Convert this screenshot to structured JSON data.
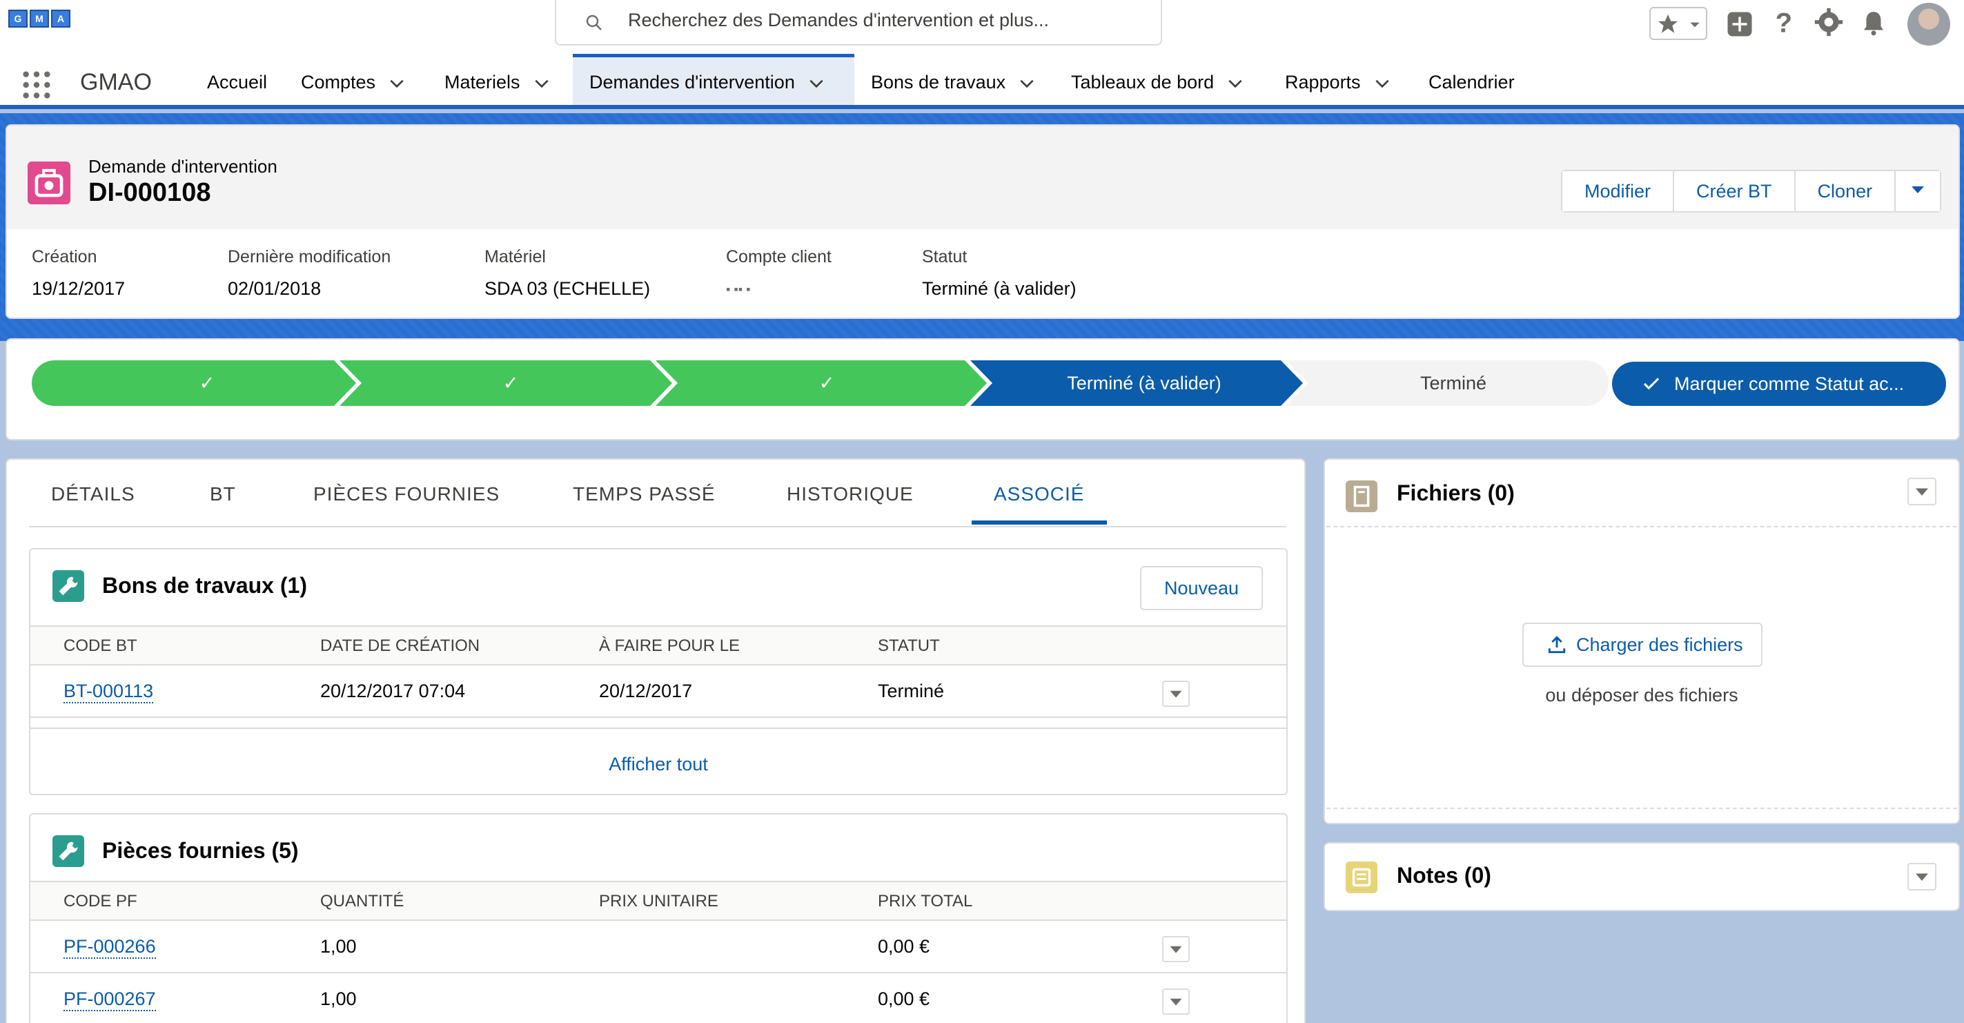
{
  "topbar": {
    "logo_letters": [
      "G",
      "M",
      "A"
    ],
    "search_placeholder": "Recherchez des Demandes d'intervention et plus..."
  },
  "nav": {
    "app_name": "GMAO",
    "items": [
      {
        "label": "Accueil",
        "has_menu": false,
        "active": false
      },
      {
        "label": "Comptes",
        "has_menu": true,
        "active": false
      },
      {
        "label": "Materiels",
        "has_menu": true,
        "active": false
      },
      {
        "label": "Demandes d'intervention",
        "has_menu": true,
        "active": true
      },
      {
        "label": "Bons de travaux",
        "has_menu": true,
        "active": false
      },
      {
        "label": "Tableaux de bord",
        "has_menu": true,
        "active": false
      },
      {
        "label": "Rapports",
        "has_menu": true,
        "active": false
      },
      {
        "label": "Calendrier",
        "has_menu": false,
        "active": false
      }
    ]
  },
  "record": {
    "object_label": "Demande d'intervention",
    "title": "DI-000108",
    "actions": [
      "Modifier",
      "Créer BT",
      "Cloner"
    ],
    "highlights": [
      {
        "label": "Création",
        "value": "19/12/2017"
      },
      {
        "label": "Dernière modification",
        "value": "02/01/2018"
      },
      {
        "label": "Matériel",
        "value": "SDA 03 (ECHELLE)"
      },
      {
        "label": "Compte client",
        "value": "▪ ▪▪ ▪"
      },
      {
        "label": "Statut",
        "value": "Terminé (à valider)"
      }
    ]
  },
  "path": {
    "steps": [
      {
        "label": "✓",
        "state": "complete"
      },
      {
        "label": "✓",
        "state": "complete"
      },
      {
        "label": "✓",
        "state": "complete"
      },
      {
        "label": "Terminé (à valider)",
        "state": "current"
      },
      {
        "label": "Terminé",
        "state": "incomplete"
      }
    ],
    "mark_button": "Marquer comme Statut ac..."
  },
  "tabs": [
    "DÉTAILS",
    "BT",
    "PIÈCES FOURNIES",
    "TEMPS PASSÉ",
    "HISTORIQUE",
    "ASSOCIÉ"
  ],
  "active_tab": "ASSOCIÉ",
  "bons": {
    "title": "Bons de travaux (1)",
    "new_label": "Nouveau",
    "columns": [
      "CODE BT",
      "DATE DE CRÉATION",
      "À FAIRE POUR LE",
      "STATUT"
    ],
    "rows": [
      [
        "BT-000113",
        "20/12/2017 07:04",
        "20/12/2017",
        "Terminé"
      ]
    ],
    "view_all": "Afficher tout"
  },
  "pieces": {
    "title": "Pièces fournies (5)",
    "columns": [
      "CODE PF",
      "QUANTITÉ",
      "PRIX UNITAIRE",
      "PRIX TOTAL"
    ],
    "rows": [
      [
        "PF-000266",
        "1,00",
        "",
        "0,00 €"
      ],
      [
        "PF-000267",
        "1,00",
        "",
        "0,00 €"
      ]
    ]
  },
  "files": {
    "title": "Fichiers (0)",
    "upload_label": "Charger des fichiers",
    "drop_label": "ou déposer des fichiers"
  },
  "notes": {
    "title": "Notes (0)"
  },
  "colors": {
    "brand": "#0b5cab",
    "complete": "#45c65a",
    "current": "#0b5cab"
  }
}
